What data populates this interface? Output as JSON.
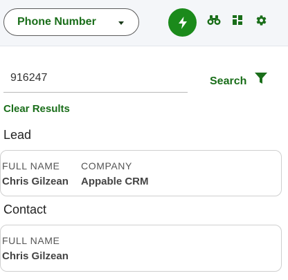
{
  "toolbar": {
    "selector_label": "Phone Number",
    "icons": [
      "bolt-icon",
      "binoculars-icon",
      "grid-icon",
      "gear-icon"
    ],
    "accent_color": "#1b8a1b"
  },
  "search": {
    "query": "916247",
    "button_label": "Search",
    "clear_label": "Clear Results"
  },
  "results": {
    "lead": {
      "title": "Lead",
      "full_name_label": "FULL NAME",
      "full_name": "Chris Gilzean",
      "company_label": "COMPANY",
      "company": "Appable CRM"
    },
    "contact": {
      "title": "Contact",
      "full_name_label": "FULL NAME",
      "full_name": "Chris Gilzean"
    }
  }
}
